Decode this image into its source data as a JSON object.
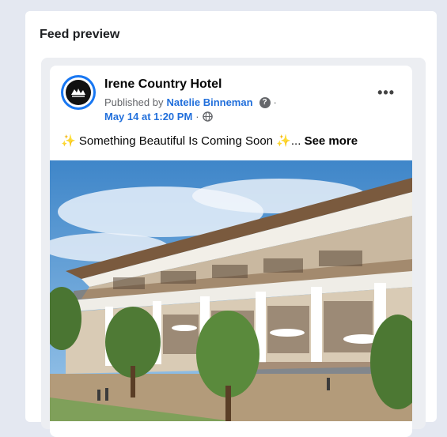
{
  "panel": {
    "title": "Feed preview"
  },
  "post": {
    "page_name": "Irene Country Hotel",
    "published_by_prefix": "Published by",
    "author": "Natelie Binneman",
    "separator": "·",
    "date": "May 14 at 1:20 PM",
    "audience_icon": "globe-icon",
    "text_sparkle": "✨",
    "text": "Something Beautiful Is Coming Soon",
    "ellipsis": "...",
    "see_more": "See more",
    "more_icon": "•••",
    "help_icon": "?",
    "image": "hotel building rendering with balconies, trees and blue sky"
  },
  "colors": {
    "link": "#216fdb",
    "background": "#e4e8f1",
    "avatar_ring": "#1877f2"
  }
}
